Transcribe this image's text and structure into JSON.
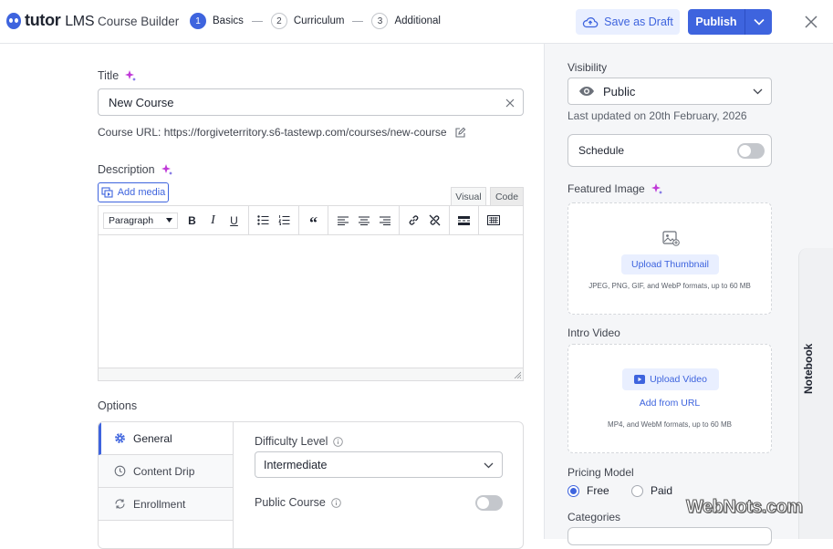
{
  "header": {
    "logo_text": "tutor",
    "logo_suffix": "LMS",
    "builder_title": "Course Builder",
    "steps": [
      {
        "num": "1",
        "label": "Basics"
      },
      {
        "num": "2",
        "label": "Curriculum"
      },
      {
        "num": "3",
        "label": "Additional"
      }
    ],
    "save_draft_label": "Save as Draft",
    "publish_label": "Publish"
  },
  "basics": {
    "title_label": "Title",
    "title_value": "New Course",
    "course_url_label": "Course URL:",
    "course_url": "https://forgiveterritory.s6-tastewp.com/courses/new-course",
    "description_label": "Description",
    "add_media_label": "Add media",
    "visual_tab": "Visual",
    "code_tab": "Code",
    "format_select": "Paragraph"
  },
  "options": {
    "heading": "Options",
    "tabs": [
      "General",
      "Content Drip",
      "Enrollment"
    ],
    "difficulty_label": "Difficulty Level",
    "difficulty_value": "Intermediate",
    "public_course_label": "Public Course"
  },
  "sidebar": {
    "visibility_label": "Visibility",
    "visibility_value": "Public",
    "last_updated": "Last updated on 20th February, 2026",
    "schedule_label": "Schedule",
    "featured_image_label": "Featured Image",
    "upload_thumbnail_label": "Upload Thumbnail",
    "thumbnail_hint": "JPEG, PNG, GIF, and WebP formats, up to 60 MB",
    "intro_video_label": "Intro Video",
    "upload_video_label": "Upload Video",
    "add_from_url_label": "Add from URL",
    "video_hint": "MP4, and WebM formats, up to 60 MB",
    "pricing_model_label": "Pricing Model",
    "pricing_options": [
      "Free",
      "Paid"
    ],
    "categories_label": "Categories"
  },
  "notebook_label": "Notebook",
  "watermark": "WebNots.com",
  "colors": {
    "accent": "#3e64de",
    "accent_light": "#e9efff",
    "ai_sparkle": "#c03ad8"
  }
}
